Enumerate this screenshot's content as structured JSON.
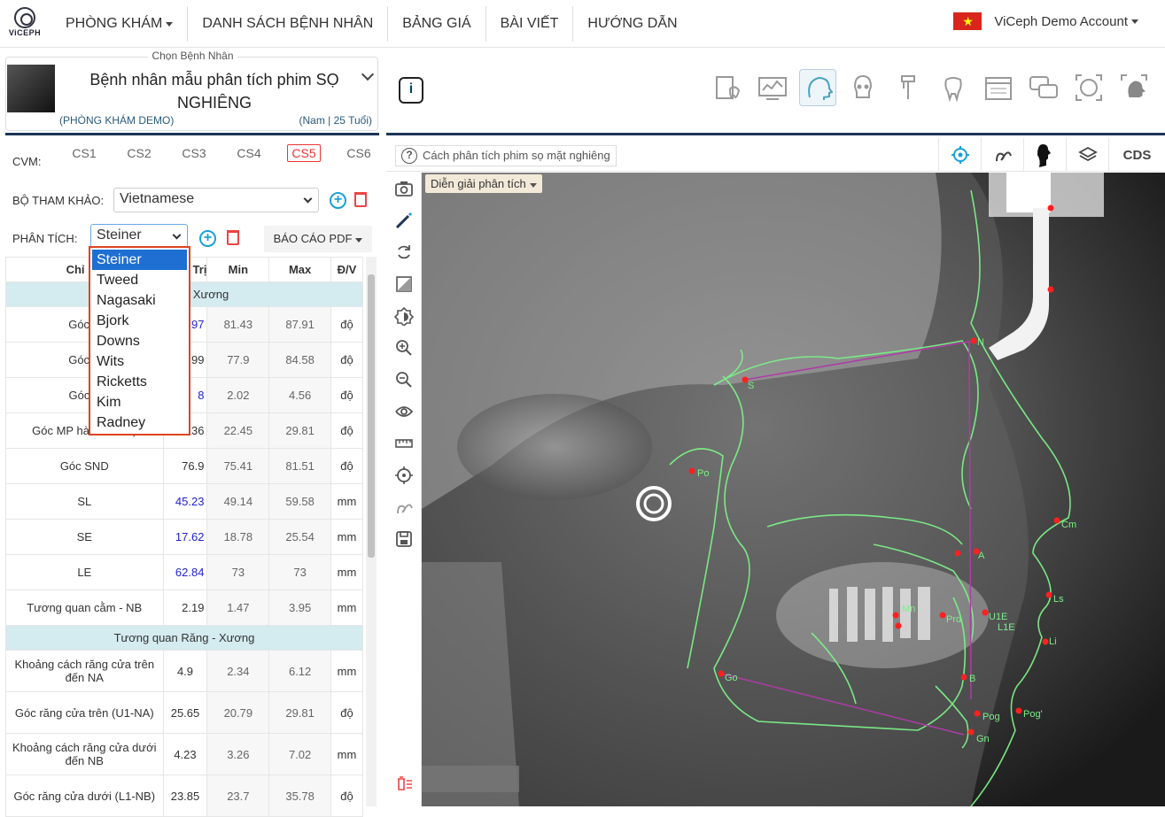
{
  "brand": {
    "logo_text": "ViCEPH"
  },
  "nav": [
    {
      "label": "PHÒNG KHÁM",
      "dropdown": true
    },
    {
      "label": "DANH SÁCH BỆNH NHÂN"
    },
    {
      "label": "BẢNG GIÁ"
    },
    {
      "label": "BÀI VIẾT"
    },
    {
      "label": "HƯỚNG DẪN"
    }
  ],
  "account": {
    "name": "ViCeph Demo Account"
  },
  "patient": {
    "caption": "Chọn Bệnh Nhân",
    "name": "Bệnh nhân mẫu phân tích phim SỌ NGHIÊNG",
    "clinic": "(PHÒNG KHÁM DEMO)",
    "meta": "(Nam | 25 Tuổi)"
  },
  "cvm": {
    "label": "CVM:",
    "tabs": [
      "CS1",
      "CS2",
      "CS3",
      "CS4",
      "CS5",
      "CS6"
    ],
    "active": "CS5"
  },
  "reference": {
    "label": "BỘ THAM KHẢO:",
    "value": "Vietnamese"
  },
  "analysis": {
    "label": "PHÂN TÍCH:",
    "value": "Steiner",
    "report": "BÁO CÁO PDF",
    "options": [
      "Steiner",
      "Tweed",
      "Nagasaki",
      "Bjork",
      "Downs",
      "Wits",
      "Ricketts",
      "Kim",
      "Radney"
    ]
  },
  "table": {
    "headers": [
      "Chỉ",
      "Trị",
      "Min",
      "Max",
      "Đ/V"
    ],
    "sections": [
      {
        "title": "n Xương",
        "rows": [
          {
            "name": "Góc S",
            "val": "97",
            "min": "81.43",
            "max": "87.91",
            "unit": "độ",
            "blue": true
          },
          {
            "name": "Góc S",
            "val": "99",
            "min": "77.9",
            "max": "84.58",
            "unit": "độ",
            "blue": false
          },
          {
            "name": "Góc A",
            "val": "8",
            "min": "2.02",
            "max": "4.56",
            "unit": "độ",
            "blue": true
          },
          {
            "name": "Góc MP hàm GoGn)",
            "val": "36",
            "min": "22.45",
            "max": "29.81",
            "unit": "độ",
            "blue": false
          },
          {
            "name": "Góc SND",
            "val": "76.9",
            "min": "75.41",
            "max": "81.51",
            "unit": "độ",
            "blue": false
          },
          {
            "name": "SL",
            "val": "45.23",
            "min": "49.14",
            "max": "59.58",
            "unit": "mm",
            "blue": true
          },
          {
            "name": "SE",
            "val": "17.62",
            "min": "18.78",
            "max": "25.54",
            "unit": "mm",
            "blue": true
          },
          {
            "name": "LE",
            "val": "62.84",
            "min": "73",
            "max": "73",
            "unit": "mm",
            "blue": true
          },
          {
            "name": "Tương quan cằm - NB",
            "val": "2.19",
            "min": "1.47",
            "max": "3.95",
            "unit": "mm",
            "blue": false
          }
        ]
      },
      {
        "title": "Tương quan Răng - Xương",
        "rows": [
          {
            "name": "Khoảng cách răng cửa trên đến NA",
            "val": "4.9",
            "min": "2.34",
            "max": "6.12",
            "unit": "mm",
            "blue": false
          },
          {
            "name": "Góc răng cửa trên (U1-NA)",
            "val": "25.65",
            "min": "20.79",
            "max": "29.81",
            "unit": "độ",
            "blue": false
          },
          {
            "name": "Khoảng cách răng cửa dưới đến NB",
            "val": "4.23",
            "min": "3.26",
            "max": "7.02",
            "unit": "mm",
            "blue": false
          },
          {
            "name": "Góc răng cửa dưới (L1-NB)",
            "val": "23.85",
            "min": "23.7",
            "max": "35.78",
            "unit": "độ",
            "blue": false
          }
        ]
      }
    ]
  },
  "viewer": {
    "help": "Cách phân tích phim sọ mặt nghiêng",
    "cds": "CDS",
    "chip": "Diễn giải phân tích",
    "landmarks": [
      "N",
      "S",
      "Po",
      "Cm",
      "A",
      "Ls",
      "U1E",
      "L1E",
      "Li",
      "B",
      "Pog",
      "Pog'",
      "Gn",
      "Go",
      "Prd",
      "Mn"
    ]
  }
}
